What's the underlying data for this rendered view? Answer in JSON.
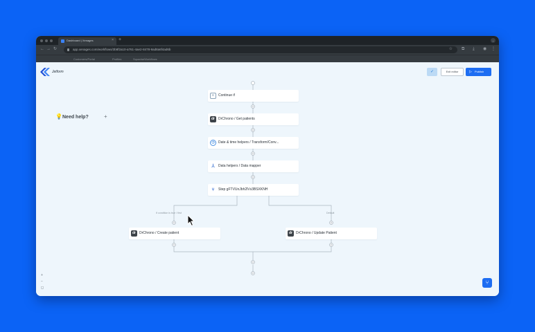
{
  "browser": {
    "tab_title": "Dashboard | Xenages",
    "tab_close": "×",
    "new_tab": "+",
    "url": "app.xenages.com/workflows/3b8f2a10-a761-4ae2-8478-9ad8a6f4ad6b",
    "window_menu": "⌄",
    "bookmarks": [
      "Customers/Portal",
      "Profiles",
      "Squadra/Workflows"
    ]
  },
  "header": {
    "logo_text": "Jetform",
    "check_icon": "✓",
    "exit_button": "Exit editor",
    "publish_button": "Publish",
    "publish_icon": "▷"
  },
  "help": {
    "icon": "💡",
    "label": "Need help?",
    "plus": "+"
  },
  "nodes": {
    "continue_if": {
      "label": "Continue if",
      "icon": "≡"
    },
    "get_patients": {
      "label": "DrChrono / Get patients",
      "icon": "dr"
    },
    "datetime": {
      "label": "Date & time helpers / Transform/Conv...",
      "icon": "◷"
    },
    "mapper": {
      "label": "Data helpers / Data mapper",
      "icon": "⅄"
    },
    "branch": {
      "label": "Step gFTVUnJbh2lVs3BSXKNH",
      "icon": "⑂"
    },
    "create_patient": {
      "label": "DrChrono / Create patient",
      "icon": "dr"
    },
    "update_patient": {
      "label": "DrChrono / Update Patient",
      "icon": "dr"
    }
  },
  "branches": {
    "left_label": "If condition is true / first",
    "right_label": "Default"
  },
  "zoom_controls": [
    "+",
    "−",
    "◻"
  ],
  "fab_icon": "⑂",
  "colors": {
    "background": "#0b63f6",
    "accent": "#1d6df2",
    "canvas": "#eef6fc",
    "node_bg": "#ffffff"
  }
}
